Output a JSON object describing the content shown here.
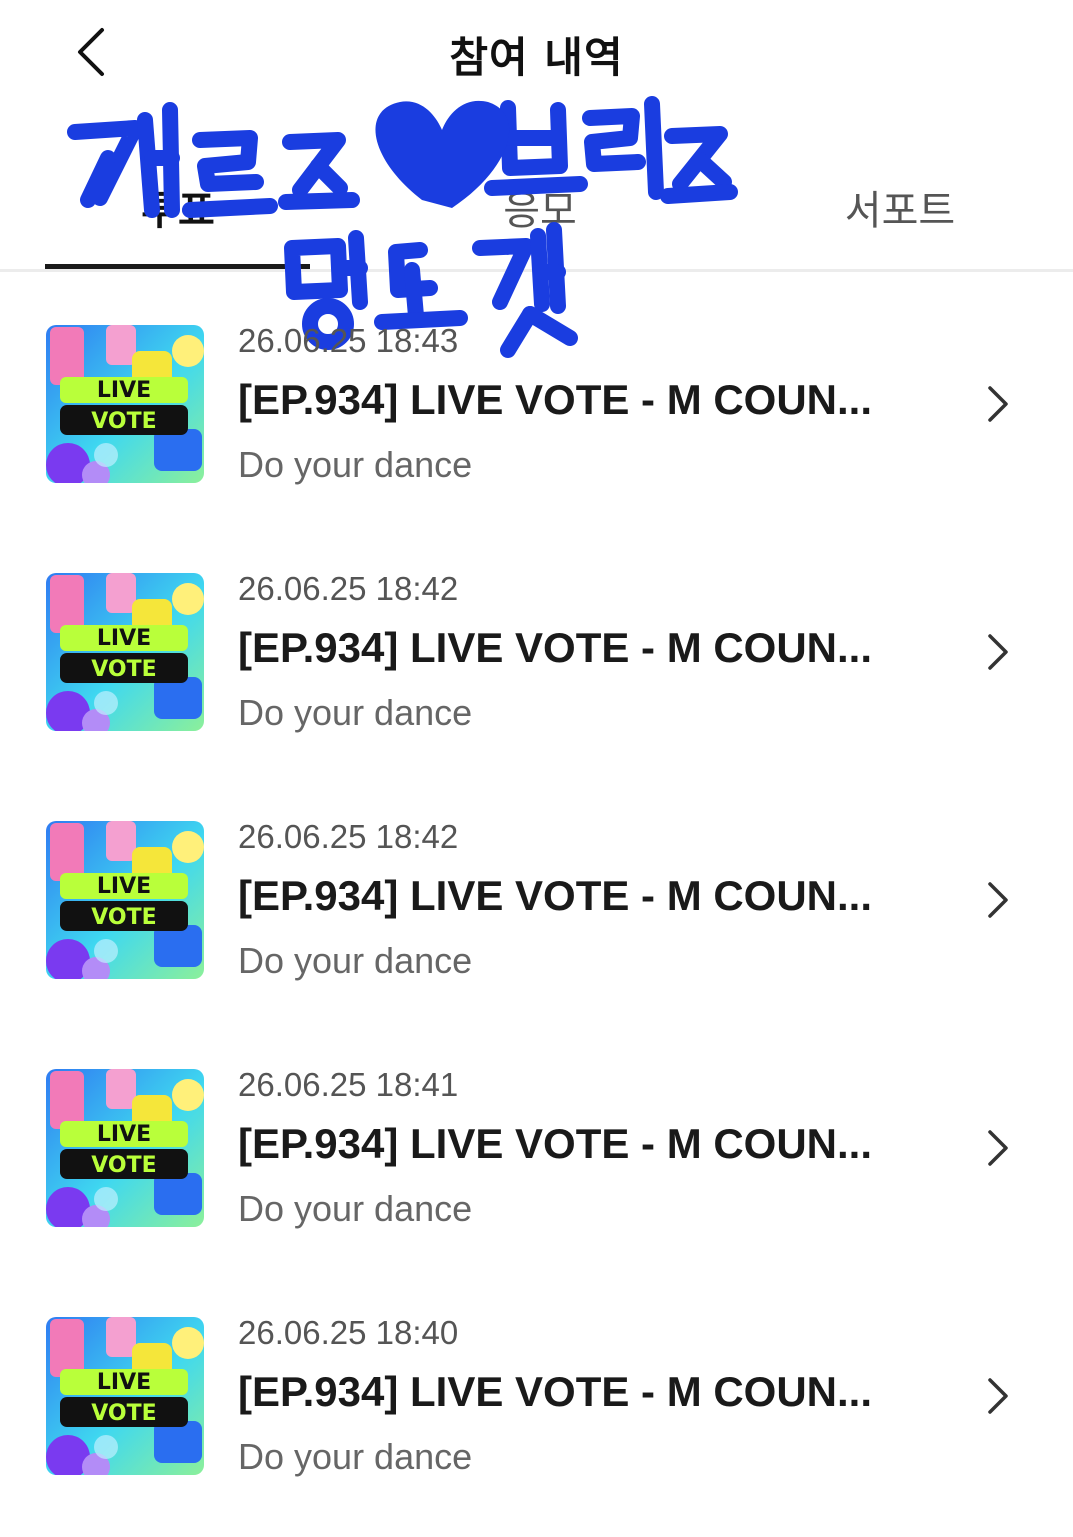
{
  "header": {
    "title": "참여 내역"
  },
  "tabs": [
    {
      "label": "투표",
      "active": true
    },
    {
      "label": "응모",
      "active": false
    },
    {
      "label": "서포트",
      "active": false
    }
  ],
  "doodle": {
    "line1": "제르즈♥브리즈",
    "line2": "멍또갯",
    "color": "#1a3de0"
  },
  "thumbnail": {
    "line1": "LIVE",
    "line2": "VOTE"
  },
  "entries": [
    {
      "date": "26.06.25 18:43",
      "title": "[EP.934] LIVE VOTE - M COUN...",
      "subtitle": "Do your dance"
    },
    {
      "date": "26.06.25 18:42",
      "title": "[EP.934] LIVE VOTE - M COUN...",
      "subtitle": "Do your dance"
    },
    {
      "date": "26.06.25 18:42",
      "title": "[EP.934] LIVE VOTE - M COUN...",
      "subtitle": "Do your dance"
    },
    {
      "date": "26.06.25 18:41",
      "title": "[EP.934] LIVE VOTE - M COUN...",
      "subtitle": "Do your dance"
    },
    {
      "date": "26.06.25 18:40",
      "title": "[EP.934] LIVE VOTE - M COUN...",
      "subtitle": "Do your dance"
    }
  ]
}
